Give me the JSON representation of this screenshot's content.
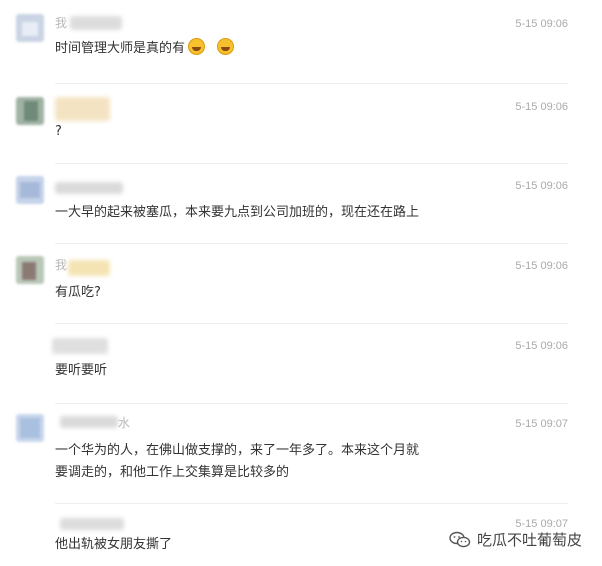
{
  "comments": [
    {
      "name_visible": "我",
      "time": "5-15 09:06",
      "text": "时间管理大师是真的有",
      "emoji": [
        "laugh-cry-emoji",
        "laugh-cry-emoji"
      ]
    },
    {
      "name_visible": "",
      "time": "5-15 09:06",
      "text": "?"
    },
    {
      "name_visible": "",
      "time": "5-15 09:06",
      "text": "一大早的起来被塞瓜，本来要九点到公司加班的，现在还在路上"
    },
    {
      "name_visible": "我",
      "time": "5-15 09:06",
      "text": "有瓜吃?"
    },
    {
      "name_visible": "",
      "time": "5-15 09:06",
      "text": "要听要听"
    },
    {
      "name_visible": "水",
      "time": "5-15 09:07",
      "text": "一个华为的人，在佛山做支撑的，来了一年多了。本来这个月就\n要调走的，和他工作上交集算是比较多的"
    },
    {
      "name_visible": "",
      "time": "5-15 09:07",
      "text": "他出轨被女朋友撕了"
    }
  ],
  "watermark": {
    "text": "吃瓜不吐葡萄皮",
    "icon": "wechat-official-account-icon"
  },
  "colors": {
    "time": "#aaaaaa",
    "text": "#333333",
    "divider": "#eeeeee"
  }
}
